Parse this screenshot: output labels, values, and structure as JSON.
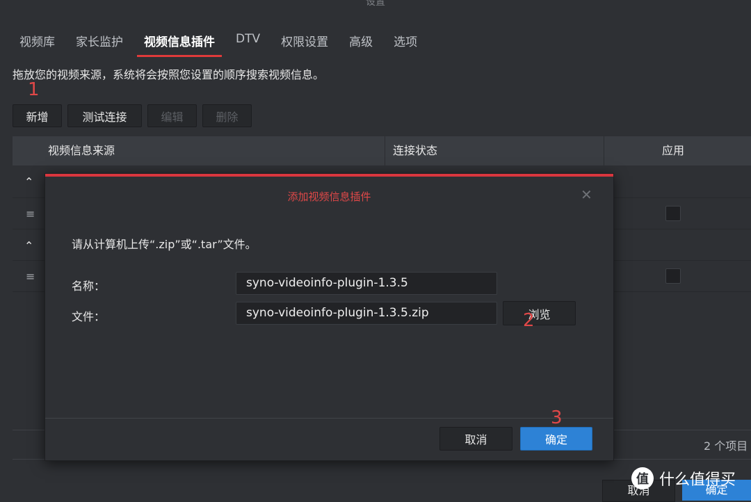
{
  "window": {
    "title": "设置"
  },
  "tabs": [
    {
      "label": "视频库"
    },
    {
      "label": "家长监护"
    },
    {
      "label": "视频信息插件"
    },
    {
      "label": "DTV"
    },
    {
      "label": "权限设置"
    },
    {
      "label": "高级"
    },
    {
      "label": "选项"
    }
  ],
  "active_tab_index": 2,
  "description": "拖放您的视频来源，系统将会按照您设置的顺序搜索视频信息。",
  "annotations": {
    "step1": "1",
    "step2": "2",
    "step3": "3",
    "color": "#e04848"
  },
  "toolbar": {
    "add": "新增",
    "test": "测试连接",
    "edit": "编辑",
    "delete": "删除"
  },
  "grid": {
    "columns": [
      "视频信息来源",
      "连接状态",
      "应用"
    ],
    "rows": [
      {
        "type": "group",
        "icon": "chevron-up-icon",
        "symbol": "⌃"
      },
      {
        "type": "item",
        "icon": "drag-handle-icon",
        "symbol": "≡",
        "applied": false
      },
      {
        "type": "group",
        "icon": "chevron-up-icon",
        "symbol": "⌃"
      },
      {
        "type": "item",
        "icon": "drag-handle-icon",
        "symbol": "≡",
        "applied": false
      }
    ],
    "count_label": "2 个项目"
  },
  "modal": {
    "title": "添加视频信息插件",
    "close_symbol": "✕",
    "message": "请从计算机上传“.zip”或“.tar”文件。",
    "name_label": "名称：",
    "name_value": "syno-videoinfo-plugin-1.3.5",
    "file_label": "文件：",
    "file_value": "syno-videoinfo-plugin-1.3.5.zip",
    "browse": "浏览",
    "cancel": "取消",
    "ok": "确定",
    "accent": "#d9363e"
  },
  "outer_footer": {
    "cancel": "取消",
    "ok": "确定"
  },
  "watermark": {
    "logo": "值",
    "text": "什么值得买"
  },
  "colors": {
    "primary": "#2d82d6",
    "background": "#2e3034"
  }
}
